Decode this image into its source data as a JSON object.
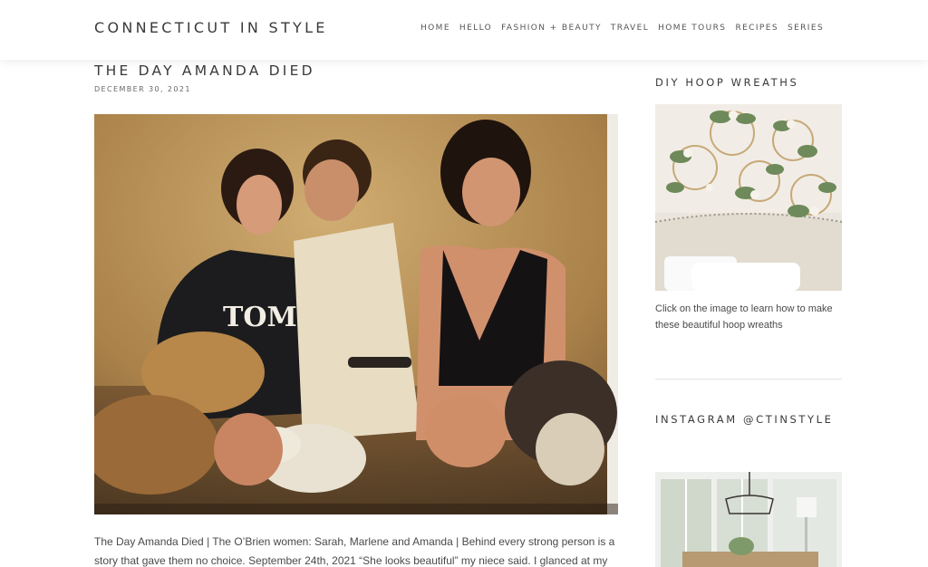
{
  "site": {
    "title": "CONNECTICUT IN STYLE"
  },
  "nav": {
    "items": [
      {
        "label": "HOME"
      },
      {
        "label": "HELLO"
      },
      {
        "label": "FASHION + BEAUTY"
      },
      {
        "label": "TRAVEL"
      },
      {
        "label": "HOME TOURS"
      },
      {
        "label": "RECIPES"
      },
      {
        "label": "SERIES"
      }
    ]
  },
  "post": {
    "title": "THE DAY AMANDA DIED",
    "date": "DECEMBER 30, 2021",
    "hero_text": "TOM",
    "excerpt": "The Day Amanda Died | The O’Brien women: Sarah, Marlene and Amanda | Behind every strong person is a story that gave them no choice. September 24th, 2021 “She looks beautiful” my niece said. I glanced at my"
  },
  "sidebar": {
    "widget1": {
      "heading": "DIY HOOP WREATHS",
      "caption": "Click on the image to learn how to make these beautiful hoop wreaths"
    },
    "widget2": {
      "heading": "INSTAGRAM @CTINSTYLE"
    }
  },
  "colors": {
    "heading_text": "#3a3a3a",
    "body_text": "#4a4a4a",
    "photo_wall": "#b08a52"
  }
}
